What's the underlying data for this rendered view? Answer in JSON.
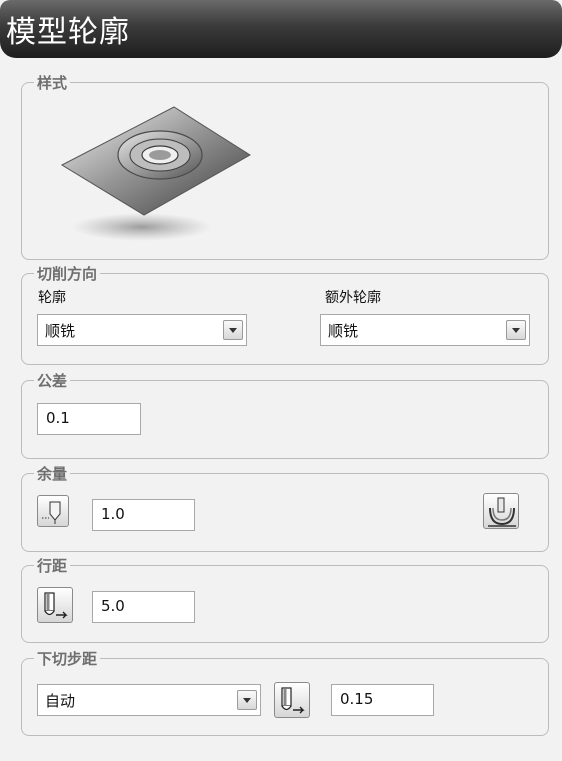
{
  "window": {
    "title": "模型轮廓"
  },
  "style_group": {
    "legend": "样式",
    "preview_icon": "model-profile-preview"
  },
  "cut_direction": {
    "legend": "切削方向",
    "profile_label": "轮廓",
    "profile_value": "顺铣",
    "extra_profile_label": "额外轮廓",
    "extra_profile_value": "顺铣"
  },
  "tolerance": {
    "legend": "公差",
    "value": "0.1"
  },
  "stock": {
    "legend": "余量",
    "value": "1.0",
    "icons": [
      "stock-tool-icon",
      "stock-component-icon"
    ]
  },
  "stepover": {
    "legend": "行距",
    "value": "5.0",
    "icon": "tool-stepover-icon"
  },
  "stepdown": {
    "legend": "下切步距",
    "mode_value": "自动",
    "value": "0.15",
    "icon": "tool-stepdown-icon"
  }
}
